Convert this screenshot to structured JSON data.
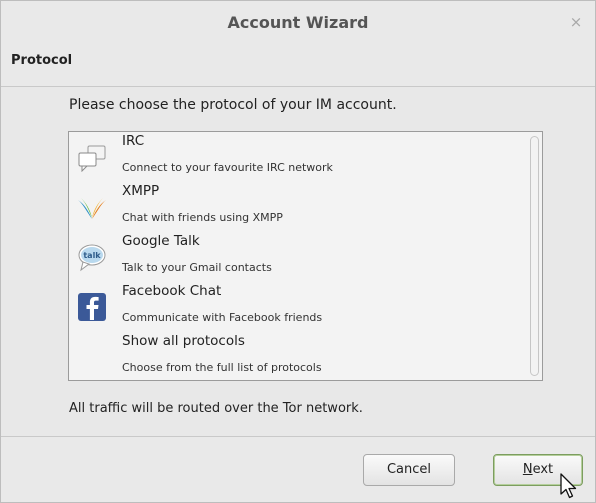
{
  "window": {
    "title": "Account Wizard",
    "close_glyph": "×"
  },
  "header": {
    "title": "Protocol"
  },
  "content": {
    "prompt": "Please choose the protocol of your IM account.",
    "protocols": [
      {
        "name": "IRC",
        "description": "Connect to your favourite IRC network",
        "icon": "irc-chat-bubbles-icon"
      },
      {
        "name": "XMPP",
        "description": "Chat with friends using XMPP",
        "icon": "xmpp-bulb-icon"
      },
      {
        "name": "Google Talk",
        "description": "Talk to your Gmail contacts",
        "icon": "google-talk-icon"
      },
      {
        "name": "Facebook Chat",
        "description": "Communicate with Facebook friends",
        "icon": "facebook-icon"
      },
      {
        "name": "Show all protocols",
        "description": "Choose from the full list of protocols",
        "icon": ""
      }
    ],
    "tor_note": "All traffic will be routed over the Tor network.",
    "google_talk_icon_text": "talk"
  },
  "footer": {
    "cancel_label": "Cancel",
    "next_label_accel": "N",
    "next_label_rest": "ext"
  },
  "colors": {
    "window_bg": "#e9e9e9",
    "list_bg": "#f3f3f3",
    "facebook_blue": "#3b5998",
    "next_border": "#7c9d5f"
  }
}
